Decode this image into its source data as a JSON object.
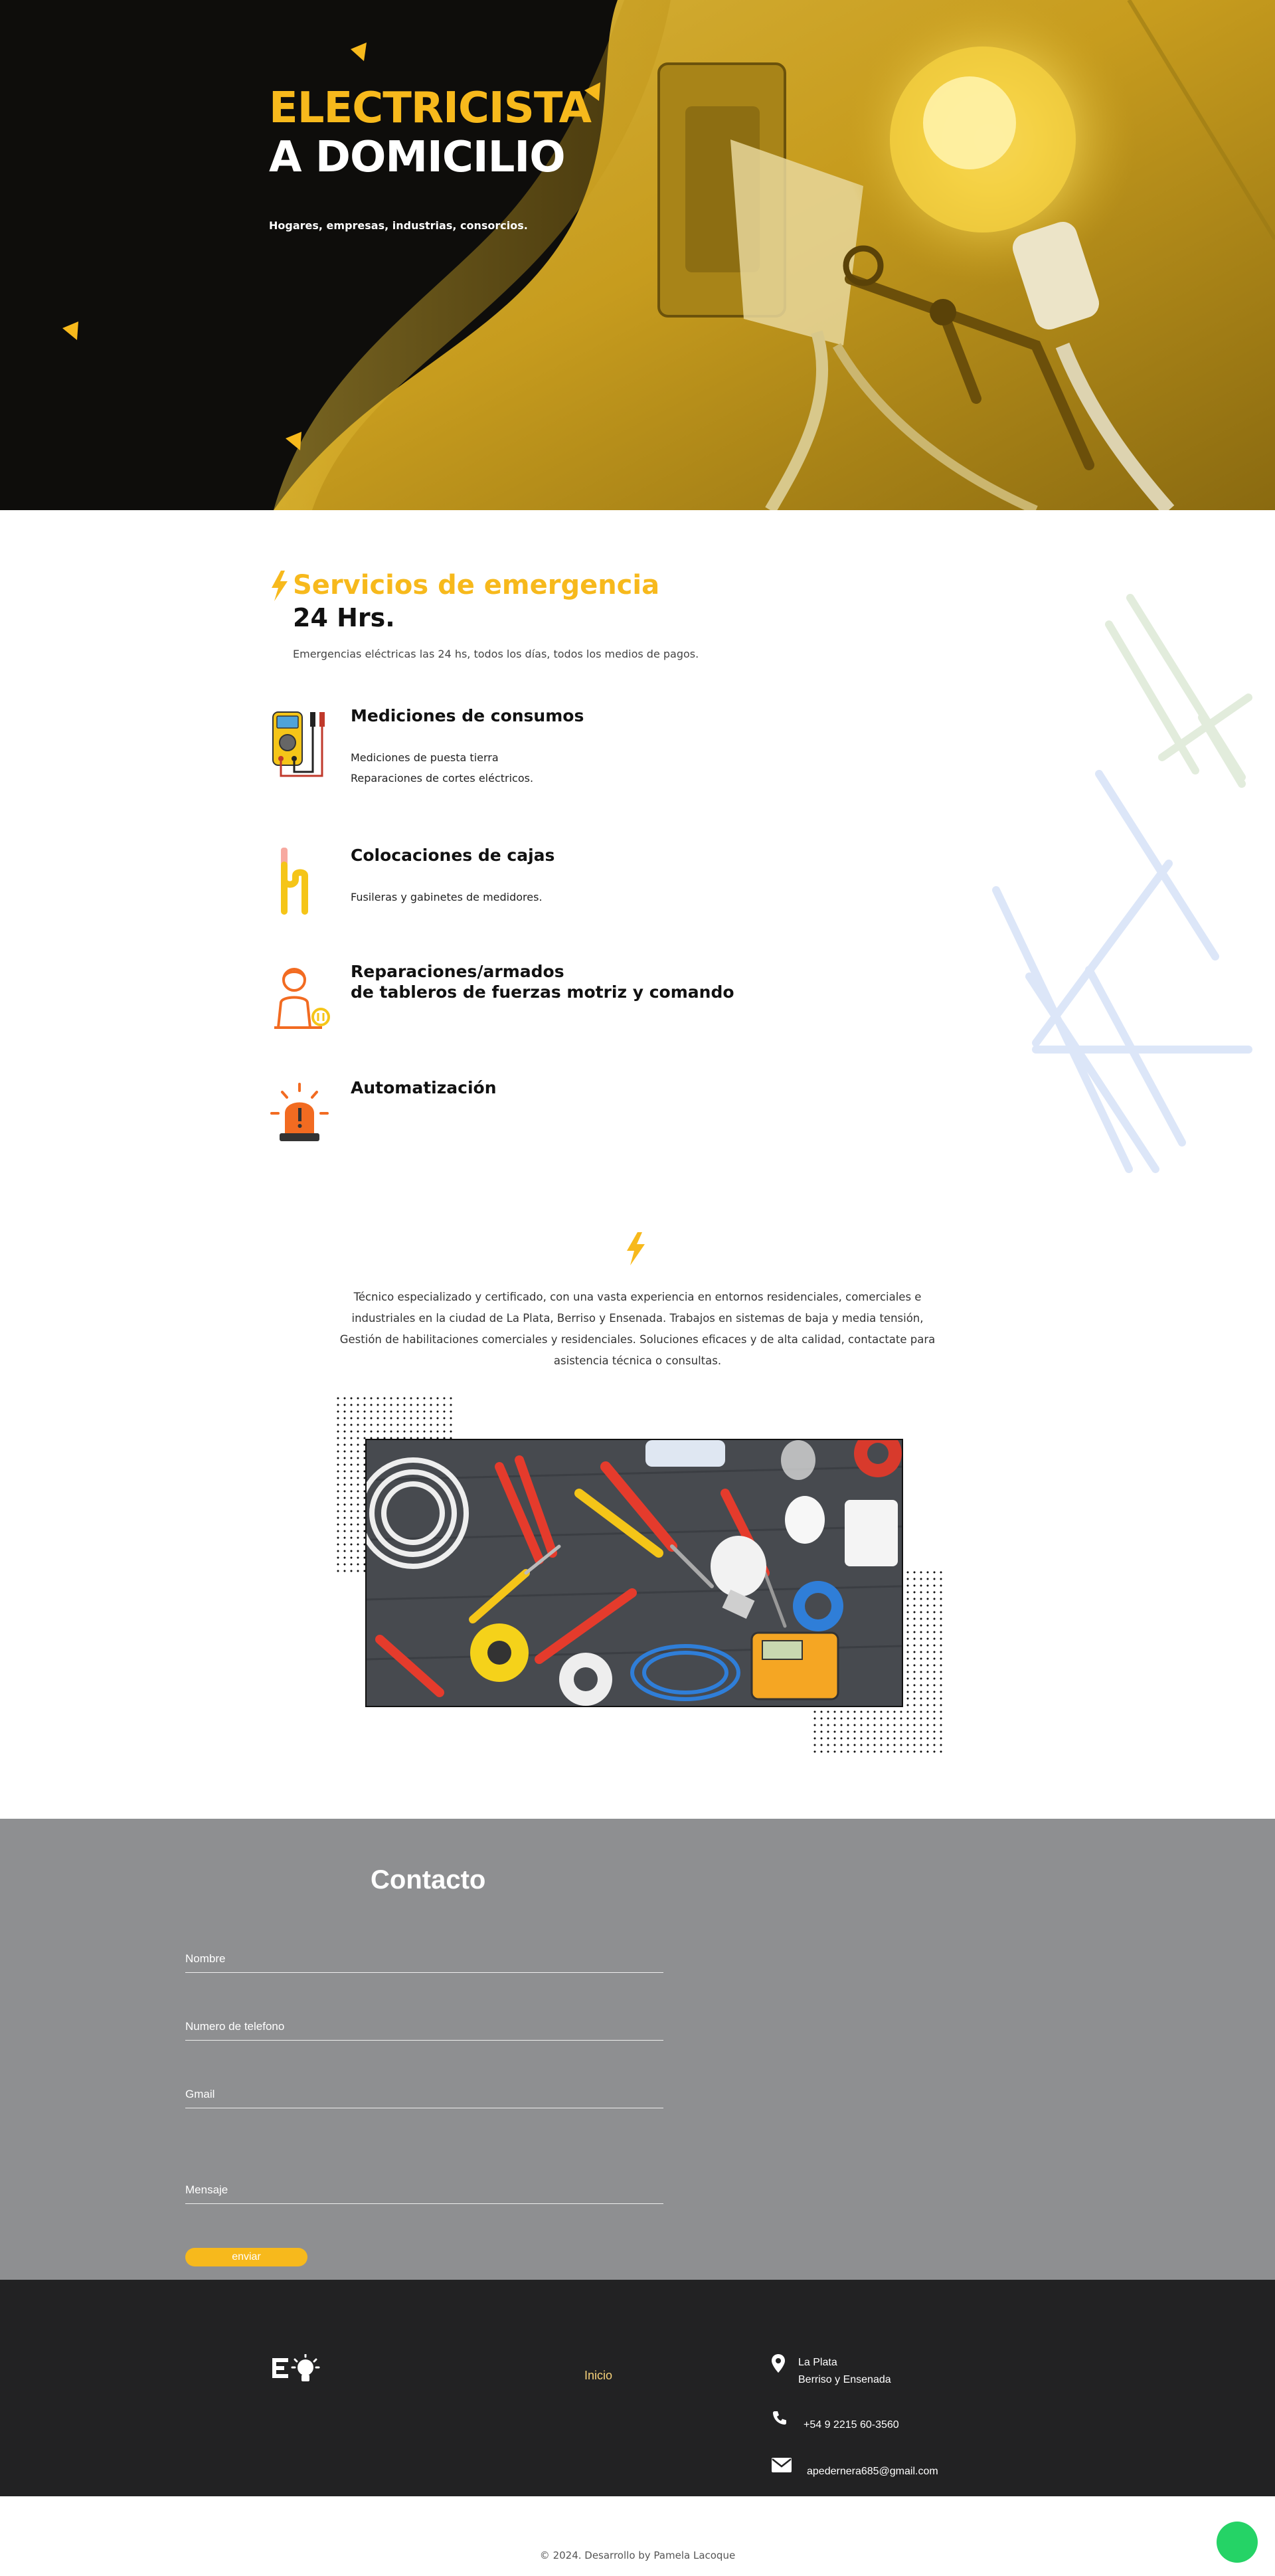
{
  "hero": {
    "title_line1": "ELECTRICISTA",
    "title_line2": "A DOMICILIO",
    "subtitle": "Hogares, empresas, industrias, consorcios."
  },
  "services": {
    "title": "Servicios de emergencia",
    "hours": "24 Hrs.",
    "description": "Emergencias eléctricas las 24 hs, todos los días, todos los medios de pagos.",
    "items": [
      {
        "icon": "multimeter-icon",
        "title_lines": [
          "Mediciones de consumos"
        ],
        "lines": [
          "Mediciones de puesta tierra",
          "Reparaciones de cortes eléctricos."
        ]
      },
      {
        "icon": "cable-icon",
        "title_lines": [
          "Colocaciones de cajas"
        ],
        "lines": [
          "Fusileras y gabinetes de medidores."
        ]
      },
      {
        "icon": "electrician-icon",
        "title_lines": [
          "Reparaciones/armados",
          "de tableros de fuerzas motriz y comando"
        ],
        "lines": []
      },
      {
        "icon": "alarm-light-icon",
        "title_lines": [
          "Automatización"
        ],
        "lines": []
      }
    ]
  },
  "about": {
    "text": "Técnico especializado y certificado, con una vasta experiencia en entornos residenciales, comerciales e industriales en la ciudad de La Plata, Berriso y Ensenada. Trabajos en sistemas de baja y media tensión, Gestión de habilitaciones comerciales y residenciales. Soluciones eficaces y de alta calidad, contactate para asistencia técnica o consultas."
  },
  "contact": {
    "title": "Contacto",
    "fields": [
      {
        "placeholder": "Nombre"
      },
      {
        "placeholder": "Numero de telefono"
      },
      {
        "placeholder": "Gmail"
      },
      {
        "placeholder": "Mensaje"
      }
    ],
    "submit_label": "enviar"
  },
  "footer": {
    "nav_label": "Inicio",
    "location_line1": "La Plata",
    "location_line2": "Berriso y Ensenada",
    "phone": "+54 9 2215 60-3560",
    "email": "apedernera685@gmail.com",
    "copyright": "© 2024. Desarrollo by Pamela Lacoque"
  },
  "colors": {
    "accent": "#f7b91c",
    "hero_dark": "#0e0d0b",
    "contact_bg": "#8e8f91",
    "footer_bg": "#222223",
    "whatsapp": "#25d366"
  }
}
